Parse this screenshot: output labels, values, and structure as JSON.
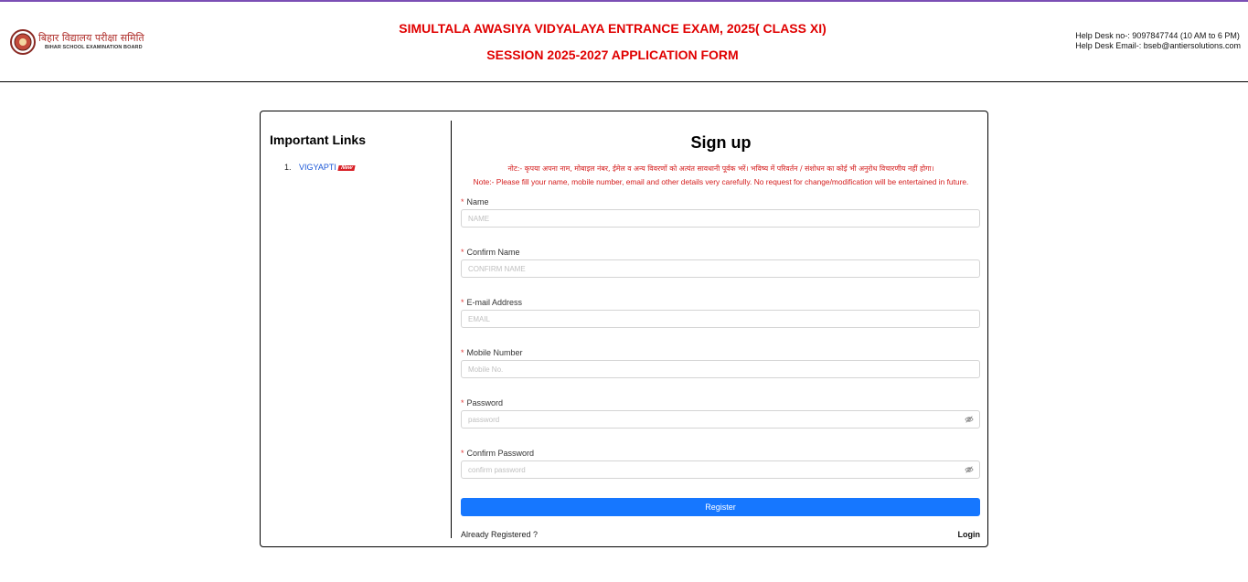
{
  "header": {
    "board_hindi": "बिहार विद्यालय परीक्षा समिति",
    "board_english": "BIHAR SCHOOL EXAMINATION BOARD",
    "title_line1": "SIMULTALA AWASIYA VIDYALAYA ENTRANCE EXAM, 2025( CLASS XI)",
    "title_line2": "SESSION 2025-2027 APPLICATION FORM",
    "helpdesk_phone": "Help Desk no-: 9097847744 (10 AM to 6 PM)",
    "helpdesk_email": "Help Desk Email-: bseb@antiersolutions.com"
  },
  "sidebar": {
    "title": "Important Links",
    "links": [
      {
        "number": "1.",
        "label": "VIGYAPTI",
        "badge": "New"
      }
    ]
  },
  "form": {
    "title": "Sign up",
    "note_hindi": "नोट:- कृपया अपना नाम, मोबाइल नंबर, ईमेल व अन्य विवरणों को अत्यंत सावधानी पूर्वक भरें। भविष्य में परिवर्तन / संशोधन का कोई भी अनुरोध विचारणीय नहीं होगा।",
    "note_english": "Note:- Please fill your name, mobile number, email and other details very carefully. No request for change/modification will be entertained in future.",
    "required_mark": "*",
    "fields": [
      {
        "label": "Name",
        "placeholder": "NAME",
        "value": ""
      },
      {
        "label": "Confirm Name",
        "placeholder": "CONFIRM NAME",
        "value": ""
      },
      {
        "label": "E-mail Address",
        "placeholder": "EMAIL",
        "value": ""
      },
      {
        "label": "Mobile Number",
        "placeholder": "Mobile No.",
        "value": ""
      },
      {
        "label": "Password",
        "placeholder": "password",
        "value": ""
      },
      {
        "label": "Confirm Password",
        "placeholder": "confirm password",
        "value": ""
      }
    ],
    "register_label": "Register",
    "already_registered": "Already Registered ?",
    "login_label": "Login"
  },
  "icons": {
    "password_toggle": "eye-slash-icon",
    "logo": "bseb-seal-icon"
  },
  "colors": {
    "title": "#e00000",
    "note": "#d41c1c",
    "button": "#1677ff",
    "link": "#1a56d6",
    "badge": "#d81f26"
  }
}
